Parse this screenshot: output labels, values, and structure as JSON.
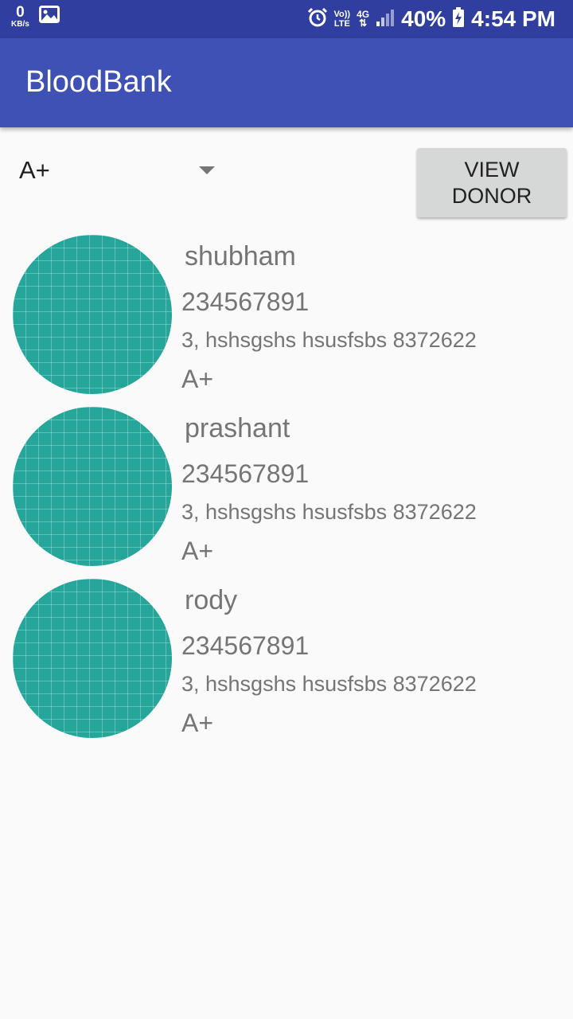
{
  "status_bar": {
    "speed_value": "0",
    "speed_unit": "KB/s",
    "volte_top": "Vo))",
    "volte_bottom": "LTE",
    "network_type": "4G",
    "battery": "40%",
    "time": "4:54 PM",
    "icons": [
      "image-icon",
      "alarm-icon",
      "signal-icon",
      "battery-charging-icon"
    ]
  },
  "app_bar": {
    "title": "BloodBank"
  },
  "filter": {
    "selected_blood_group": "A+"
  },
  "view_donor_button": {
    "label": "VIEW DONOR"
  },
  "colors": {
    "status_bar": "#303f9f",
    "app_bar": "#3f51b5",
    "avatar": "#26a69a",
    "button": "#d6d7d7"
  },
  "donors": [
    {
      "name": "shubham",
      "phone": "234567891",
      "address": "3, hshsgshs hsusfsbs 8372622",
      "blood_group": "A+"
    },
    {
      "name": "prashant",
      "phone": "234567891",
      "address": "3, hshsgshs hsusfsbs 8372622",
      "blood_group": "A+"
    },
    {
      "name": "rody",
      "phone": "234567891",
      "address": "3, hshsgshs hsusfsbs 8372622",
      "blood_group": "A+"
    }
  ]
}
